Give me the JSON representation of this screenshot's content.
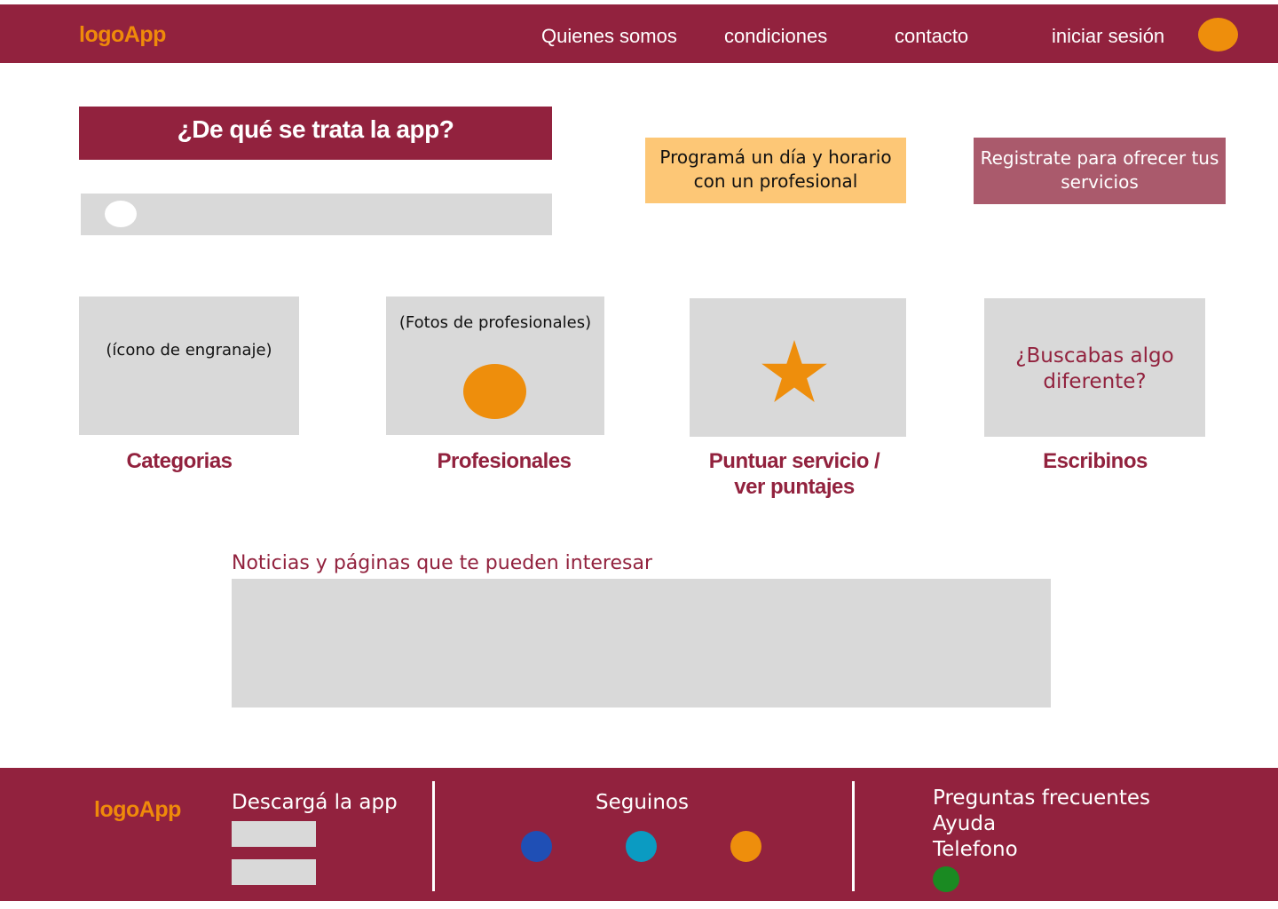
{
  "header": {
    "logo": "logoApp",
    "nav": [
      "Quienes somos",
      "condiciones",
      "contacto",
      "iniciar sesión"
    ],
    "avatar_color": "#ee8e0c"
  },
  "hero": {
    "title": "¿De qué se trata la app?",
    "cta_schedule": "Programá un día y  horario con un profesional",
    "cta_register": "Registrate para ofrecer tus servicios"
  },
  "features": [
    {
      "card_text": "(ícono de engranaje)",
      "label": "Categorias"
    },
    {
      "card_text": "(Fotos de profesionales)",
      "label": "Profesionales"
    },
    {
      "card_text": "",
      "label": "Puntuar servicio / ver puntajes",
      "icon": "star-icon"
    },
    {
      "card_text": "¿Buscabas algo diferente?",
      "label": "Escribinos"
    }
  ],
  "news": {
    "title": "Noticias y páginas que te pueden interesar"
  },
  "footer": {
    "logo": "logoApp",
    "download": "Descargá la app",
    "follow": "Seguinos",
    "social_colors": [
      "#1f4fb5",
      "#0b9bc2",
      "#ee8e0c"
    ],
    "links": [
      "Preguntas frecuentes",
      "Ayuda",
      "Telefono"
    ]
  },
  "colors": {
    "brand": "#92223e",
    "accent": "#ee8e0c",
    "placeholder": "#d9d9d9"
  }
}
